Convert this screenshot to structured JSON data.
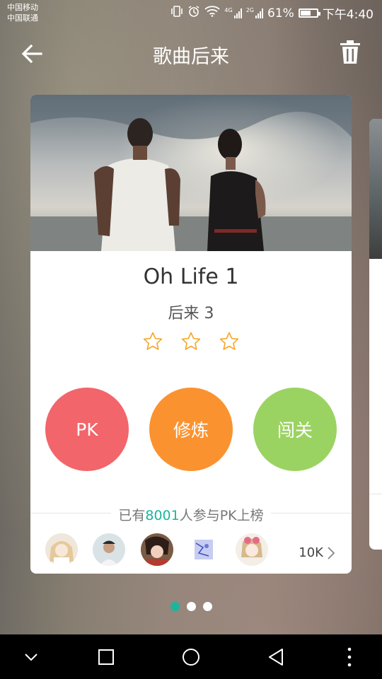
{
  "status_bar": {
    "carrier_1": "中国移动",
    "carrier_2": "中国联通",
    "network_1": "4G",
    "network_2": "2G",
    "battery": "61%",
    "battery_level": 0.61,
    "time": "下午4:40"
  },
  "header": {
    "title": "歌曲后来",
    "back_icon": "arrow-left-icon",
    "delete_icon": "trash-icon"
  },
  "card": {
    "title": "Oh Life 1",
    "subtitle": "后来 3",
    "stars_filled": 0,
    "stars_total": 3,
    "actions": [
      {
        "label": "PK",
        "color": "#f2656a"
      },
      {
        "label": "修炼",
        "color": "#fb9230"
      },
      {
        "label": "闯关",
        "color": "#9bd362"
      }
    ],
    "participants_prefix": "已有",
    "participants_count": "8001",
    "participants_suffix": "人参与PK上榜",
    "ranking_count": "10K"
  },
  "pager": {
    "total": 3,
    "active": 0
  },
  "colors": {
    "accent": "#1cb59c",
    "star": "#f5a623"
  }
}
